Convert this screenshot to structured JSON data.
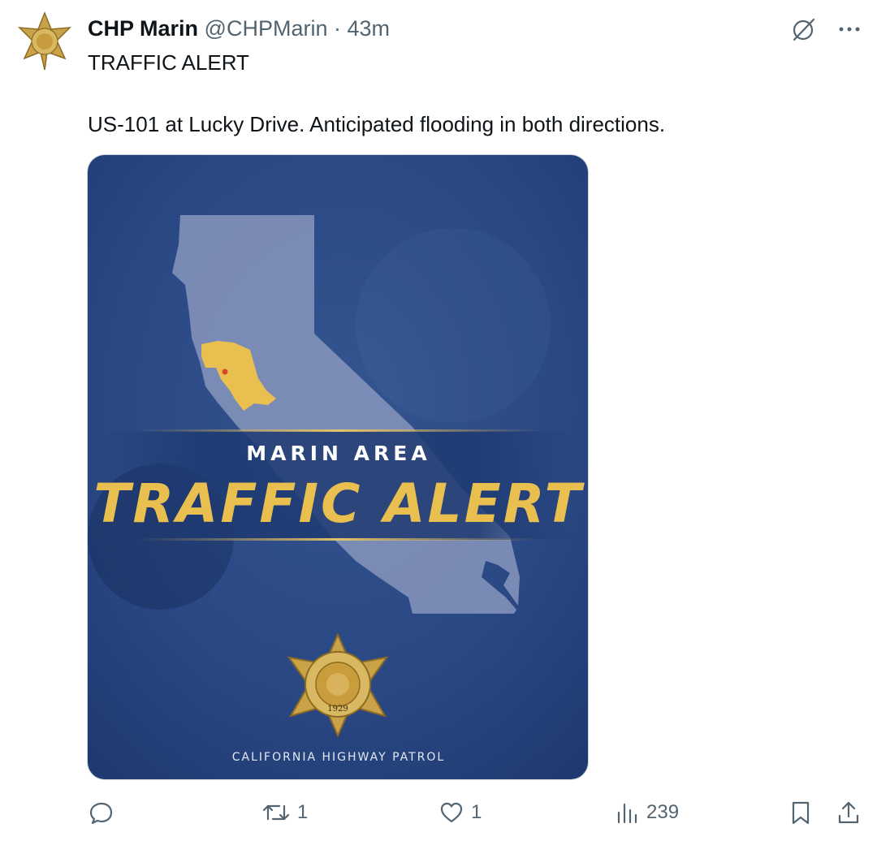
{
  "author": {
    "name": "CHP Marin",
    "handle": "@CHPMarin",
    "separator": "·",
    "time": "43m"
  },
  "tweet": {
    "line1": "TRAFFIC ALERT",
    "line2": "US-101 at Lucky Drive. Anticipated flooding in both directions."
  },
  "media": {
    "subtitle": "MARIN AREA",
    "headline": "TRAFFIC ALERT",
    "footer": "CALIFORNIA HIGHWAY PATROL",
    "badge_text": "CALIFORNIA HIGHWAY PATROL",
    "badge_year": "1929",
    "colors": {
      "background": "#26447f",
      "accent": "#e9c04f",
      "state": "#8f9cc2"
    }
  },
  "actions": {
    "reply_count": "",
    "retweet_count": "1",
    "like_count": "1",
    "views_count": "239"
  },
  "icons": [
    "grok-icon",
    "more-icon",
    "reply-icon",
    "retweet-icon",
    "like-icon",
    "views-icon",
    "bookmark-icon",
    "share-icon"
  ]
}
